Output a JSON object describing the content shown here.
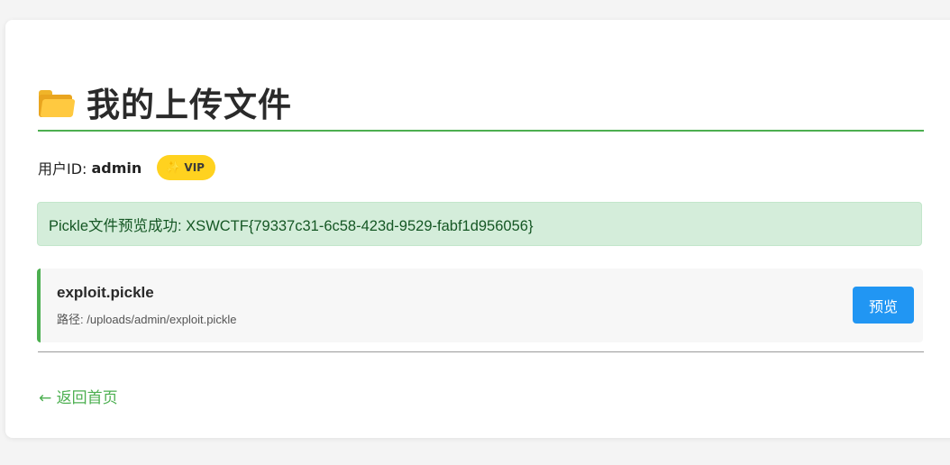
{
  "page": {
    "title": "我的上传文件",
    "folder_icon": "folder-icon"
  },
  "user": {
    "label": "用户ID:",
    "id": "admin",
    "badge": {
      "icon": "sparkle-icon",
      "label": "VIP",
      "color": "#ffd21f"
    }
  },
  "alert": {
    "message": "Pickle文件预览成功: XSWCTF{79337c31-6c58-423d-9529-fabf1d956056}",
    "type": "success",
    "color": "#d4edda"
  },
  "files": [
    {
      "name": "exploit.pickle",
      "path": "路径: /uploads/admin/exploit.pickle",
      "action_label": "预览"
    }
  ],
  "footer": {
    "back_link": "← 返回首页"
  },
  "colors": {
    "accent": "#4caf50",
    "button": "#2196f3"
  }
}
